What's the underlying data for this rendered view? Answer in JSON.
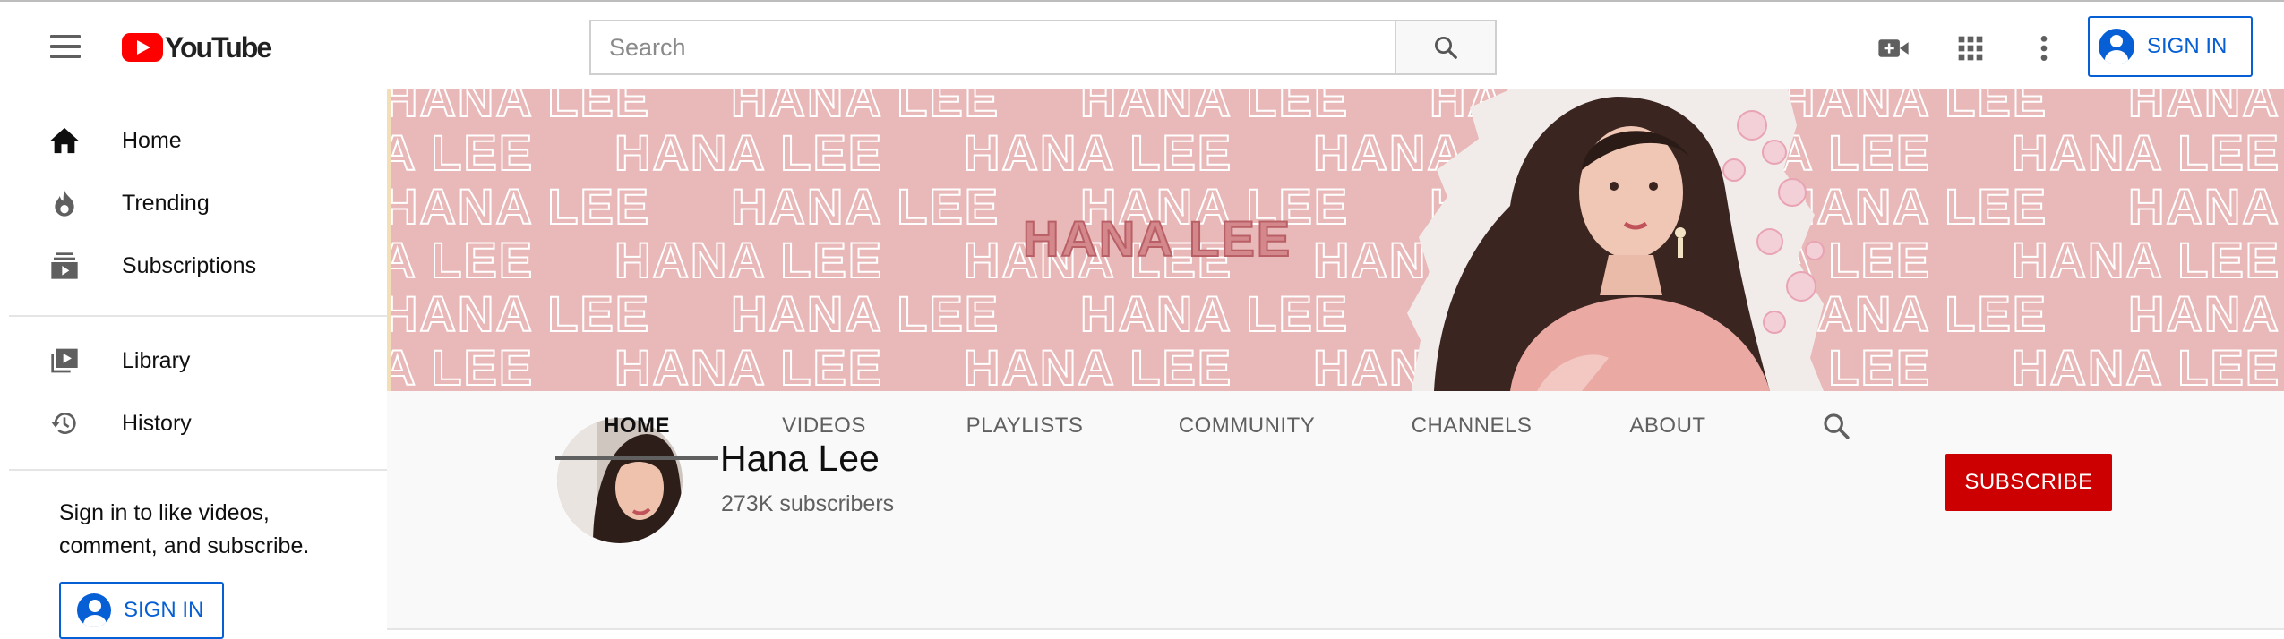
{
  "header": {
    "menu_icon": "hamburger-menu-icon",
    "logo_text": "YouTube",
    "search": {
      "placeholder": "Search",
      "value": ""
    },
    "icons": [
      "create-video-icon",
      "apps-grid-icon",
      "more-vert-icon"
    ],
    "sign_in_label": "SIGN IN"
  },
  "sidebar": {
    "items": [
      {
        "label": "Home",
        "icon": "home-icon"
      },
      {
        "label": "Trending",
        "icon": "flame-icon"
      },
      {
        "label": "Subscriptions",
        "icon": "subscriptions-icon"
      },
      {
        "label": "Library",
        "icon": "library-icon"
      },
      {
        "label": "History",
        "icon": "history-icon"
      }
    ],
    "signin_prompt": "Sign in to like videos, comment, and subscribe.",
    "sign_in_label": "SIGN IN"
  },
  "banner": {
    "pattern_text": "HANA LEE",
    "colors": {
      "background": "#e9b8b8",
      "accent": "#c9787c"
    }
  },
  "channel": {
    "name": "Hana Lee",
    "subscribers": "273K subscribers",
    "subscribe_label": "SUBSCRIBE",
    "tabs": [
      "HOME",
      "VIDEOS",
      "PLAYLISTS",
      "COMMUNITY",
      "CHANNELS",
      "ABOUT"
    ],
    "active_tab": "HOME"
  },
  "colors": {
    "brand_red": "#ff0000",
    "subscribe_red": "#cc0000",
    "link_blue": "#065fd4"
  }
}
